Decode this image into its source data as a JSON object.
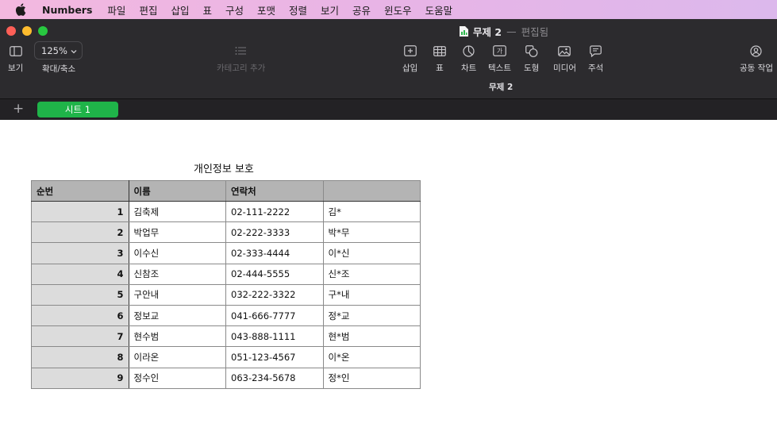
{
  "menubar": {
    "app_name": "Numbers",
    "items": [
      "파일",
      "편집",
      "삽입",
      "표",
      "구성",
      "포맷",
      "정렬",
      "보기",
      "공유",
      "윈도우",
      "도움말"
    ]
  },
  "window": {
    "title": "무제 2",
    "separator": "—",
    "status": "편집됨"
  },
  "toolbar": {
    "view_label": "보기",
    "zoom_value": "125%",
    "zoom_label": "확대/축소",
    "add_category_label": "카테고리 추가",
    "insert_label": "삽입",
    "table_label": "표",
    "chart_label": "차트",
    "text_label": "텍스트",
    "text_icon_glyph": "가",
    "shape_label": "도형",
    "media_label": "미디어",
    "comment_label": "주석",
    "collaborate_label": "공동 작업",
    "doc_subtitle": "무제 2"
  },
  "sheets": {
    "add_symbol": "+",
    "tabs": [
      "시트 1"
    ]
  },
  "table": {
    "title": "개인정보 보호",
    "headers": [
      "순번",
      "이름",
      "연락처",
      ""
    ],
    "rows": [
      [
        "1",
        "김축제",
        "02-111-2222",
        "김*"
      ],
      [
        "2",
        "박업무",
        "02-222-3333",
        "박*무"
      ],
      [
        "3",
        "이수신",
        "02-333-4444",
        "이*신"
      ],
      [
        "4",
        "신참조",
        "02-444-5555",
        "신*조"
      ],
      [
        "5",
        "구안내",
        "032-222-3322",
        "구*내"
      ],
      [
        "6",
        "정보교",
        "041-666-7777",
        "정*교"
      ],
      [
        "7",
        "현수범",
        "043-888-1111",
        "현*범"
      ],
      [
        "8",
        "이라온",
        "051-123-4567",
        "이*온"
      ],
      [
        "9",
        "정수인",
        "063-234-5678",
        "정*인"
      ]
    ]
  },
  "colors": {
    "sheet_tab": "#1fb449",
    "toolbar_bg": "#2c2b2e",
    "header_bg": "#b4b4b4"
  }
}
